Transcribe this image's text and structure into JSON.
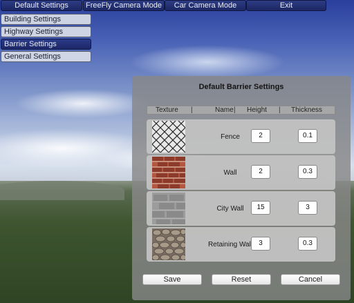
{
  "menu": {
    "tabs": [
      "Default Settings",
      "FreeFly Camera Mode",
      "Car Camera Mode",
      "Exit"
    ]
  },
  "submenu": {
    "items": [
      "Building Settings",
      "Highway Settings",
      "Barrier Settings",
      "General Settings"
    ],
    "active": "Barrier Settings"
  },
  "panel": {
    "title": "Default Barrier Settings",
    "columns": [
      "Texture",
      "Name",
      "Height",
      "Thickness"
    ],
    "rows": [
      {
        "name": "Fence",
        "height": "2",
        "thickness": "0.1",
        "texture": "chain-link-fence"
      },
      {
        "name": "Wall",
        "height": "2",
        "thickness": "0.3",
        "texture": "brick"
      },
      {
        "name": "City Wall",
        "height": "15",
        "thickness": "3",
        "texture": "stone-blocks"
      },
      {
        "name": "Retaining Wall",
        "height": "3",
        "thickness": "0.3",
        "texture": "cobblestone"
      }
    ],
    "buttons": {
      "save": "Save",
      "reset": "Reset",
      "cancel": "Cancel"
    }
  }
}
